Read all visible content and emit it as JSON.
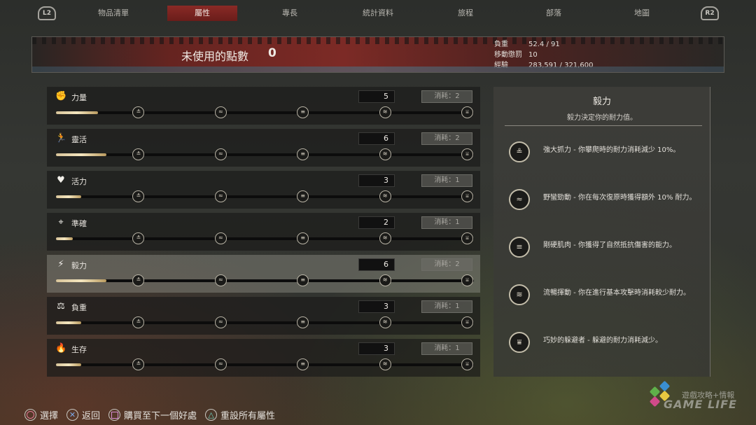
{
  "nav": {
    "left_shoulder": "L2",
    "right_shoulder": "R2",
    "tabs": [
      {
        "label": "物品清單"
      },
      {
        "label": "屬性"
      },
      {
        "label": "專長"
      },
      {
        "label": "統計資料"
      },
      {
        "label": "旅程"
      },
      {
        "label": "部落"
      },
      {
        "label": "地圖"
      }
    ],
    "active_tab": 1
  },
  "header": {
    "unused_points_label": "未使用的點數",
    "unused_points_value": "0",
    "stats": [
      {
        "label": "負重",
        "value": "52.4 / 91"
      },
      {
        "label": "移動懲罰",
        "value": "10"
      },
      {
        "label": "經驗",
        "value": "283,591 / 321,600"
      }
    ]
  },
  "attributes": [
    {
      "name": "力量",
      "icon": "fist-icon",
      "value": "5",
      "cost": "消耗：2",
      "fill": 0.1
    },
    {
      "name": "靈活",
      "icon": "running-man-icon",
      "value": "6",
      "cost": "消耗：2",
      "fill": 0.12
    },
    {
      "name": "活力",
      "icon": "heart-icon",
      "value": "3",
      "cost": "消耗：1",
      "fill": 0.06
    },
    {
      "name": "準確",
      "icon": "crosshair-icon",
      "value": "2",
      "cost": "消耗：1",
      "fill": 0.04
    },
    {
      "name": "毅力",
      "icon": "lightning-icon",
      "value": "6",
      "cost": "消耗：2",
      "fill": 0.12,
      "selected": true
    },
    {
      "name": "負重",
      "icon": "weight-icon",
      "value": "3",
      "cost": "消耗：1",
      "fill": 0.06
    },
    {
      "name": "生存",
      "icon": "campfire-icon",
      "value": "3",
      "cost": "消耗：1",
      "fill": 0.06
    }
  ],
  "description": {
    "title": "毅力",
    "subtitle": "毅力決定你的耐力值。",
    "perks": [
      {
        "icon": "perk-tier1-icon",
        "glyph": "≗",
        "text": "強大抓力 - 你攀爬時的耐力消耗減少 10%。"
      },
      {
        "icon": "perk-tier2-icon",
        "glyph": "≈",
        "text": "野蠻勁動 - 你在每次復原時獲得額外 10% 耐力。"
      },
      {
        "icon": "perk-tier3-icon",
        "glyph": "≡",
        "text": "剛硬肌肉 - 你獲得了自然抵抗傷害的能力。"
      },
      {
        "icon": "perk-tier4-icon",
        "glyph": "≋",
        "text": "流暢揮動 - 你在進行基本攻擊時消耗較少耐力。"
      },
      {
        "icon": "perk-tier5-icon",
        "glyph": "⩸",
        "text": "巧妙的躲避者 - 躲避的耐力消耗減少。"
      }
    ]
  },
  "hints": [
    {
      "button": "circle-button-icon",
      "label": "選擇"
    },
    {
      "button": "cross-button-icon",
      "label": "返回"
    },
    {
      "button": "square-button-icon",
      "label": "購買至下一個好處"
    },
    {
      "button": "triangle-button-icon",
      "label": "重設所有屬性"
    }
  ],
  "watermark": {
    "line1": "遊戲攻略+情報",
    "line2": "GAME LIFE"
  },
  "node_glyphs": [
    "≗",
    "≈",
    "≡",
    "≋",
    "⩸"
  ]
}
